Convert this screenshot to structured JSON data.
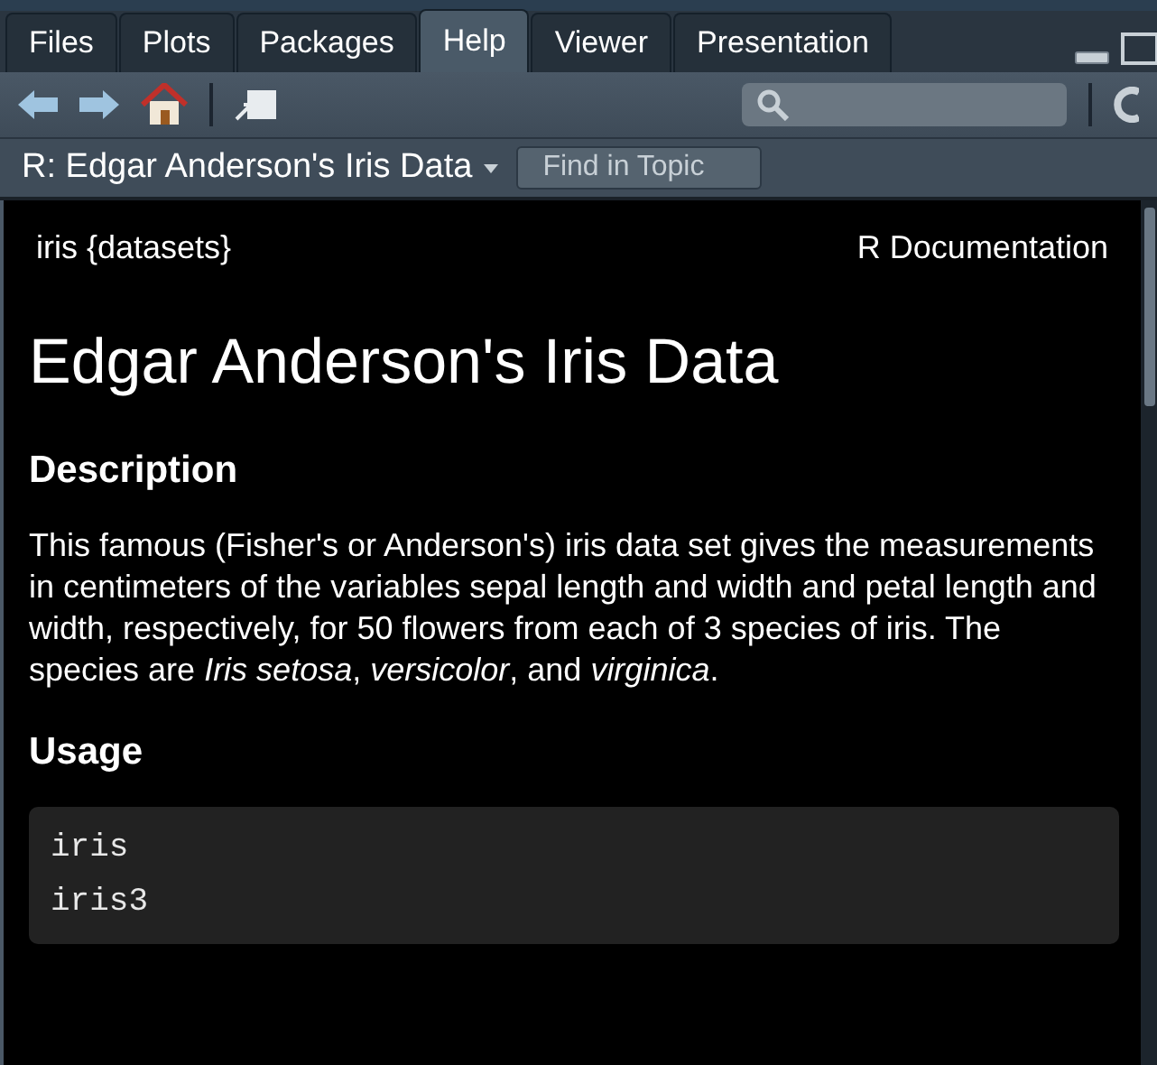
{
  "tabs": [
    {
      "label": "Files",
      "selected": false
    },
    {
      "label": "Plots",
      "selected": false
    },
    {
      "label": "Packages",
      "selected": false
    },
    {
      "label": "Help",
      "selected": true
    },
    {
      "label": "Viewer",
      "selected": false
    },
    {
      "label": "Presentation",
      "selected": false
    }
  ],
  "topic": {
    "title": "R: Edgar Anderson's Iris Data",
    "find_placeholder": "Find in Topic"
  },
  "doc": {
    "package": "iris {datasets}",
    "source": "R Documentation",
    "title": "Edgar Anderson's Iris Data",
    "sections": [
      {
        "heading": "Description",
        "kind": "text",
        "text": "This famous (Fisher's or Anderson's) iris data set gives the measurements in centimeters of the variables sepal length and width and petal length and width, respectively, for 50 flowers from each of 3 species of iris. The species are *Iris setosa*, *versicolor*, and *virginica*."
      },
      {
        "heading": "Usage",
        "kind": "code",
        "lines": [
          "iris",
          "iris3"
        ]
      }
    ]
  }
}
